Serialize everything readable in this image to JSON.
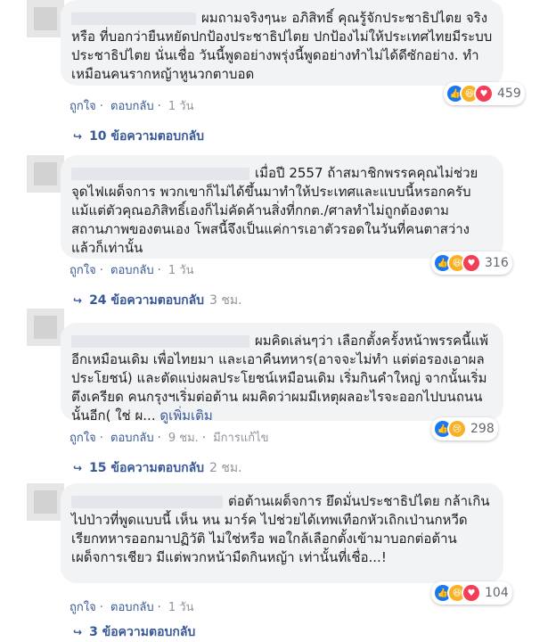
{
  "comments": [
    {
      "text": "ผมถามจริงๆนะ อภิสิทธิ์ คุณรู้จักประชาธิปไตย จริงหรือ ที่บอกว่ายืนหยัดปกป้องประชาธิปไตย ปกป้องไม่ให้ประเทศไทยมีระบบ ประชาธิปไตย นั่นเชื่อ วันนี้พูดอย่างพรุ่งนี้พูดอย่างทำไม่ได้ดีซักอย่าง. ทำเหมือนคนรากหญ้าหูนวกตาบอด",
      "reactions_count": "459",
      "like": "ถูกใจ",
      "reply": "ตอบกลับ",
      "time": "1 วัน",
      "edited": "",
      "replies": "10 ข้อความตอบกลับ",
      "reply_time": ""
    },
    {
      "text": "เมื่อปี 2557 ถ้าสมาชิกพรรคคุณไม่ช่วยจุดไฟเผด็จการ พวกเขาก็ไม่ได้ขึ้นมาทำให้ประเทศและแบบนี้หรอกครับ แม้แต่ตัวคุณอภิสิทธิ์เองก็ไม่คัดค้านสิ่งที่กกต./ศาลทำไม่ถูกต้องตามสถานภาพของตนเอง โพสนี้จึงเป็นแค่การเอาตัวรอดในวันที่คนตาสว่างแล้วก็เท่านั้น",
      "reactions_count": "316",
      "like": "ถูกใจ",
      "reply": "ตอบกลับ",
      "time": "1 วัน",
      "edited": "",
      "replies": "24 ข้อความตอบกลับ",
      "reply_time": "3 ชม."
    },
    {
      "text": "ผมคิดเล่นๆว่า เลือกตั้งครั้งหน้าพรรคนี้แพ้อีกเหมือนเดิม เพื่อไทยมา และเอาคืนทหาร(อาจจะไม่ทำ แต่ต่อรองเอาผลประโยชน์) และตัดแบ่งผลประโยชน์เหมือนเดิม เริ่มกินคำใหญ่ จากนั้นเริ่มตึงเครียด คนกรุงฯเริ่มต่อต้าน ผมคิดว่าผมมีเหตุผลอะไรจะออกไปบนถนนนั้นอีก( ใช่ ผ...",
      "more": "ดูเพิ่มเติม",
      "reactions_count": "298",
      "like": "ถูกใจ",
      "reply": "ตอบกลับ",
      "time": "9 ชม.",
      "edited": "มีการแก้ไข",
      "replies": "15 ข้อความตอบกลับ",
      "reply_time": "2 ชม."
    },
    {
      "text": "ต่อต้านเผด็จการ ยึดมั่นประชาธิปไตย กล้าเกินไปป่าวที่พูดแบบนี้ เห็น หน มาร์ค ไปช่วยได้เทพเทือกหัวเถิกเป่านกหวีดเรียกทหารออกมาปฏิวัติ ไม่ใช่หรือ พอใกล้เลือกตั้งเข้ามาบอกต่อต้านเผด็จการเชียว มีแต่พวกหน้ามืดกินหญ้า เท่านั้นที่เชื่อ...!",
      "reactions_count": "104",
      "like": "ถูกใจ",
      "reply": "ตอบกลับ",
      "time": "1 วัน",
      "edited": "",
      "replies": "3 ข้อความตอบกลับ",
      "reply_time": ""
    }
  ]
}
